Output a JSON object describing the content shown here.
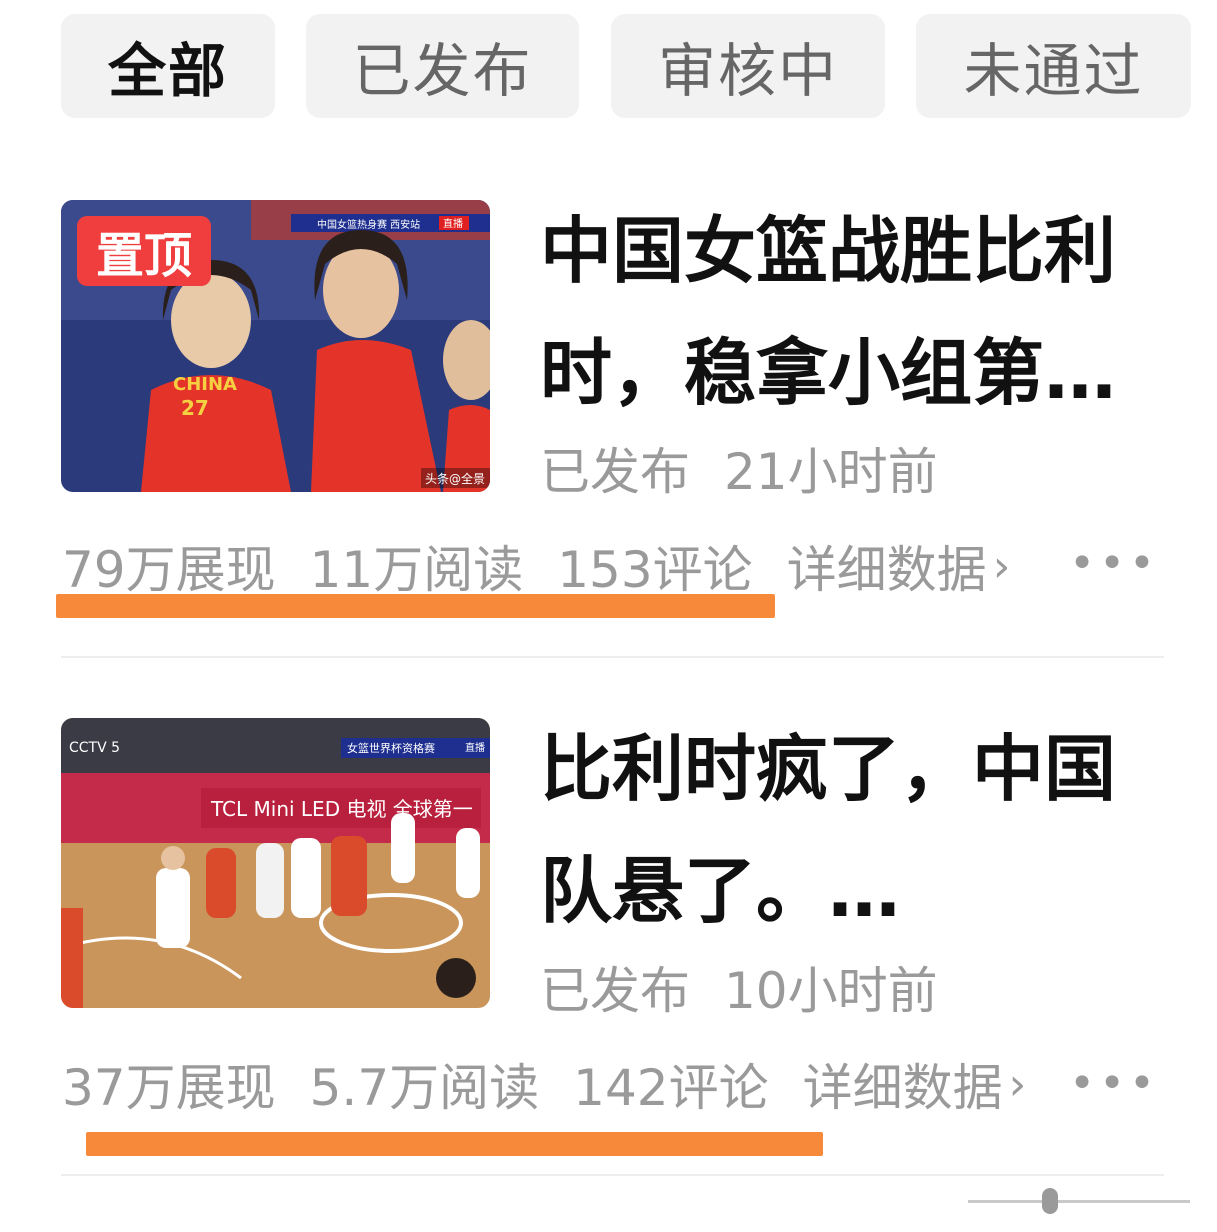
{
  "tabs": [
    {
      "label": "全部",
      "active": true
    },
    {
      "label": "已发布",
      "active": false
    },
    {
      "label": "审核中",
      "active": false
    },
    {
      "label": "未通过",
      "active": false
    }
  ],
  "articles": [
    {
      "pin_label": "置顶",
      "title": "中国女篮战胜比利时，稳拿小组第…",
      "status": "已发布",
      "time": "21小时前",
      "impressions": "79万展现",
      "reads": "11万阅读",
      "comments": "153评论",
      "detail_label": "详细数据",
      "overlay": {
        "banner": "中国女篮热身赛 西安站",
        "live": "直播",
        "watermark": "头条@全景",
        "jersey_text": "CHINA",
        "jersey_number": "27"
      }
    },
    {
      "title": "比利时疯了，中国队悬了。…",
      "status": "已发布",
      "time": "10小时前",
      "impressions": "37万展现",
      "reads": "5.7万阅读",
      "comments": "142评论",
      "detail_label": "详细数据",
      "overlay": {
        "banner": "女篮世界杯资格赛",
        "live": "直播",
        "ad": "TCL Mini LED 电视 全球第一",
        "channel": "CCTV 5"
      }
    }
  ],
  "colors": {
    "accent_underline": "#f7893a",
    "pin_badge": "#f03e3e"
  }
}
